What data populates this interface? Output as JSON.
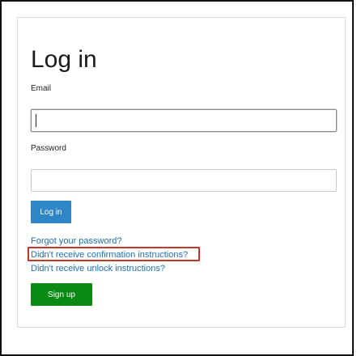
{
  "page": {
    "title": "Log in"
  },
  "form": {
    "email_label": "Email",
    "email_value": "",
    "password_label": "Password",
    "password_value": "",
    "login_button_label": "Log in"
  },
  "links": {
    "forgot_password": "Forgot your password?",
    "confirmation_instructions": "Didn't receive confirmation instructions?",
    "unlock_instructions": "Didn't receive unlock instructions?"
  },
  "signup": {
    "button_label": "Sign up"
  },
  "colors": {
    "primary_button": "#2e86c8",
    "signup_button": "#0a8a12",
    "link": "#1f6fb5",
    "highlight": "#c0392b"
  }
}
